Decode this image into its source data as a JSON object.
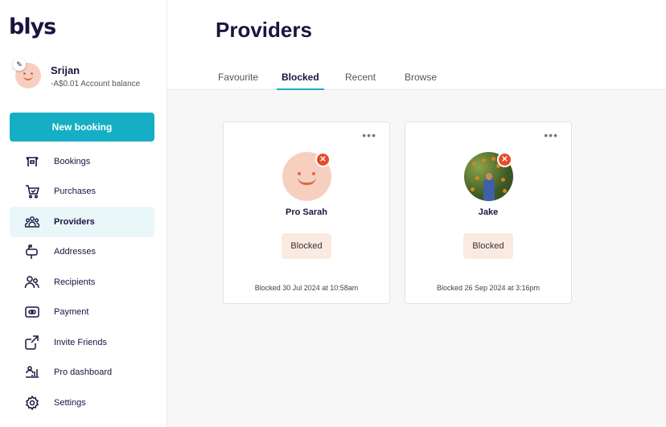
{
  "app": {
    "logo": "blys"
  },
  "user": {
    "name": "Srijan",
    "balance": "-A$0.01 Account balance"
  },
  "actions": {
    "new_booking": "New booking"
  },
  "nav": [
    {
      "label": "Bookings",
      "icon": "bookings-icon"
    },
    {
      "label": "Purchases",
      "icon": "cart-icon"
    },
    {
      "label": "Providers",
      "icon": "providers-icon",
      "active": true
    },
    {
      "label": "Addresses",
      "icon": "mailbox-icon"
    },
    {
      "label": "Recipients",
      "icon": "users-icon"
    },
    {
      "label": "Payment",
      "icon": "card-icon"
    },
    {
      "label": "Invite Friends",
      "icon": "share-icon"
    },
    {
      "label": "Pro dashboard",
      "icon": "dashboard-icon"
    },
    {
      "label": "Settings",
      "icon": "gear-icon"
    }
  ],
  "page": {
    "title": "Providers",
    "tabs": [
      {
        "label": "Favourite"
      },
      {
        "label": "Blocked",
        "active": true
      },
      {
        "label": "Recent"
      },
      {
        "label": "Browse"
      }
    ]
  },
  "providers": [
    {
      "name": "Pro Sarah",
      "status": "Blocked",
      "date": "Blocked 30 Jul 2024 at 10:58am",
      "more": "•••",
      "remove": "✕"
    },
    {
      "name": "Jake",
      "status": "Blocked",
      "date": "Blocked 26 Sep 2024 at 3:16pm",
      "more": "•••",
      "remove": "✕"
    }
  ],
  "colors": {
    "accent": "#16aec4",
    "brand_text": "#1b1340",
    "danger": "#e74a2c",
    "status_bg": "#fbeae2"
  }
}
